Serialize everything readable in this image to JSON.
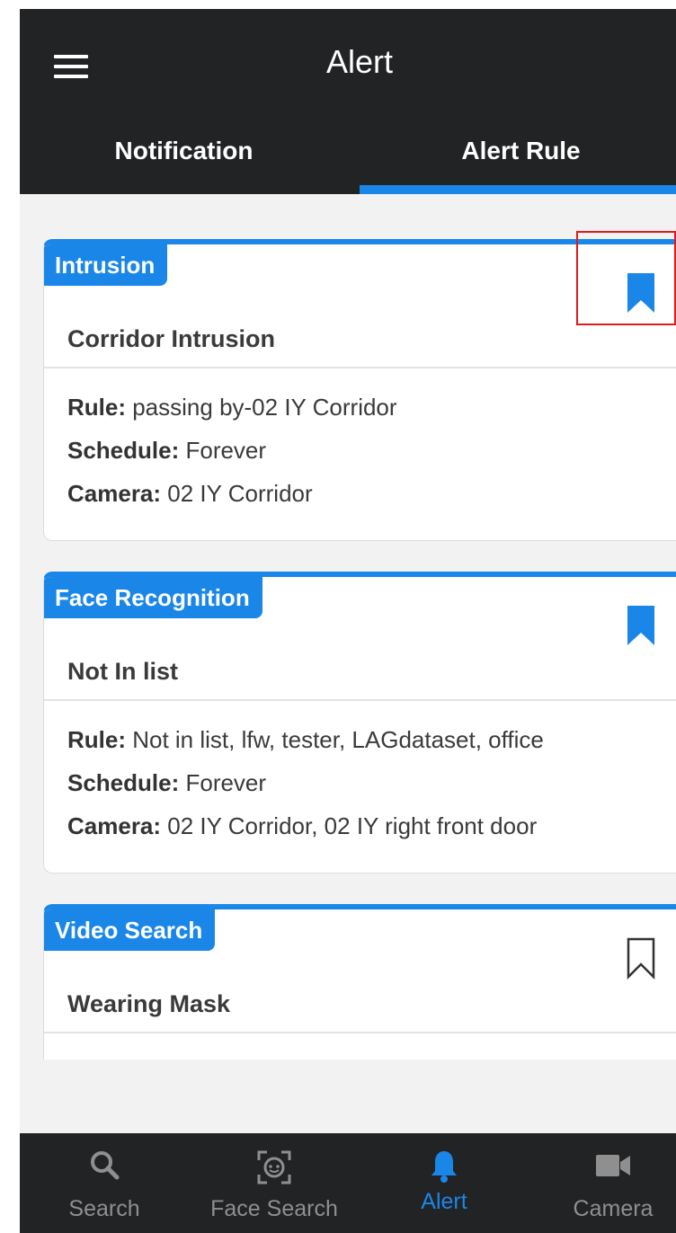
{
  "header": {
    "title": "Alert",
    "menu_icon": "hamburger-menu-icon"
  },
  "tabs": [
    {
      "label": "Notification",
      "active": false
    },
    {
      "label": "Alert Rule",
      "active": true
    }
  ],
  "accent_color": "#1a87e8",
  "rules": [
    {
      "type": "Intrusion",
      "name": "Corridor Intrusion",
      "bookmarked": true,
      "rule_label": "Rule:",
      "rule_value": " passing by-02 IY Corridor",
      "schedule_label": "Schedule:",
      "schedule_value": " Forever",
      "camera_label": "Camera:",
      "camera_value": " 02 IY Corridor"
    },
    {
      "type": "Face Recognition",
      "name": "Not In list",
      "bookmarked": true,
      "rule_label": "Rule:",
      "rule_value": " Not in list, lfw, tester, LAGdataset, office",
      "schedule_label": "Schedule:",
      "schedule_value": " Forever",
      "camera_label": "Camera:",
      "camera_value": " 02 IY Corridor, 02 IY right front door"
    },
    {
      "type": "Video Search",
      "name": "Wearing Mask",
      "bookmarked": false
    }
  ],
  "bottom_nav": [
    {
      "label": "Search",
      "icon": "search-icon",
      "active": false
    },
    {
      "label": "Face Search",
      "icon": "face-scan-icon",
      "active": false
    },
    {
      "label": "Alert",
      "icon": "bell-icon",
      "active": true
    },
    {
      "label": "Camera",
      "icon": "video-camera-icon",
      "active": false
    }
  ]
}
